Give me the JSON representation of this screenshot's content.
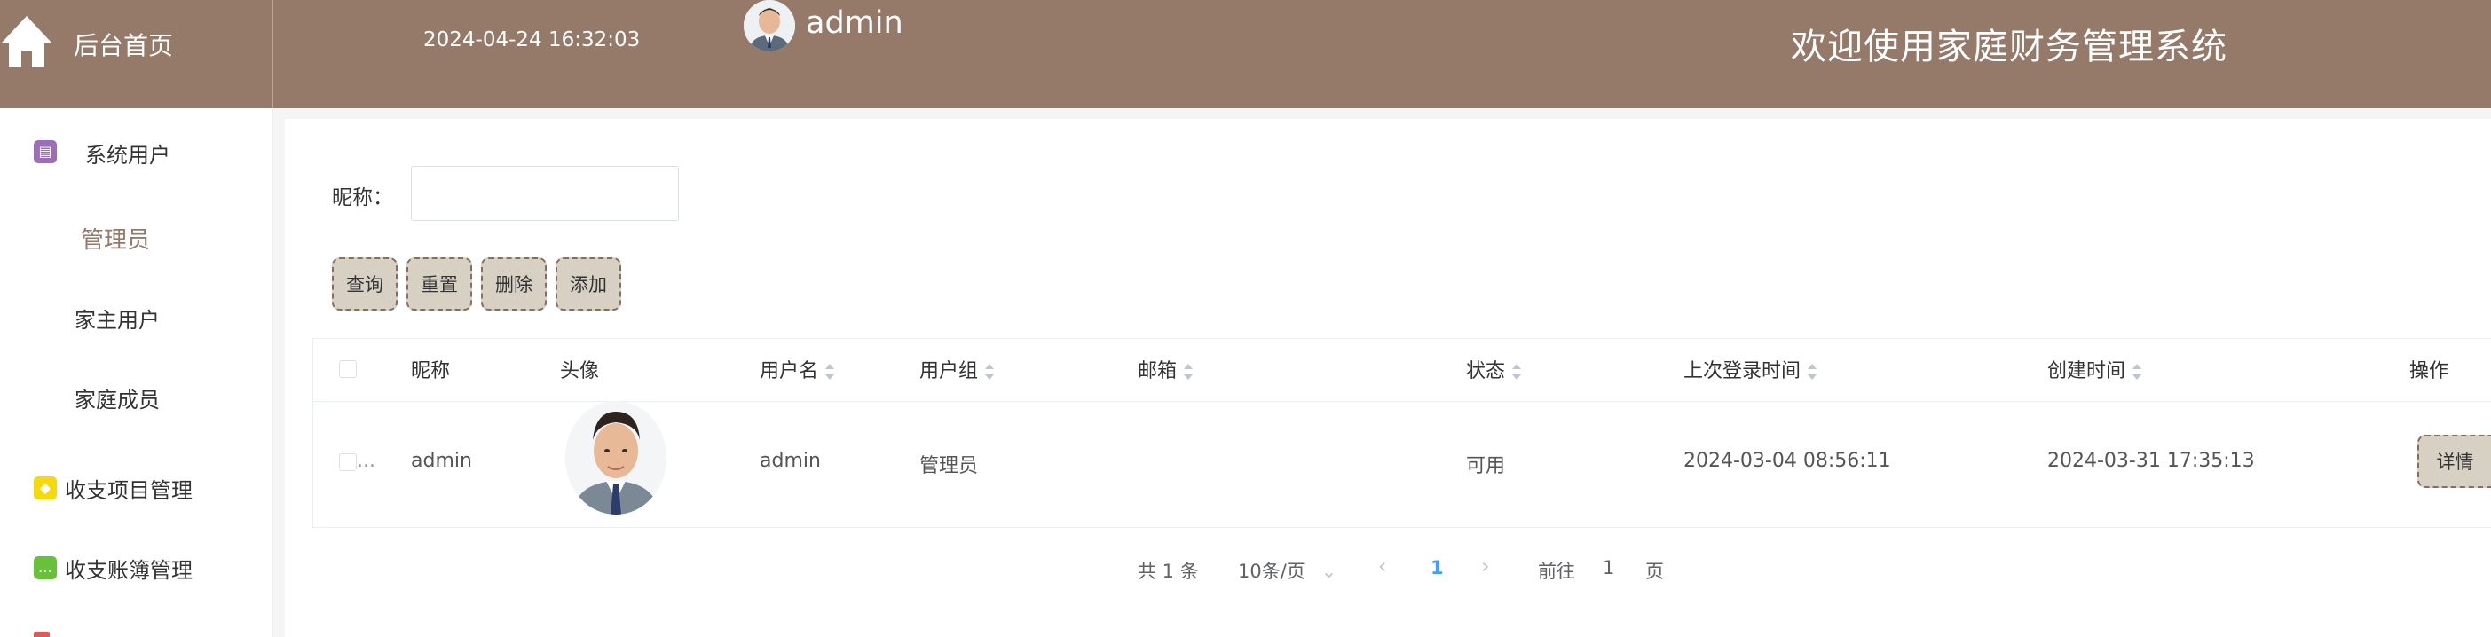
{
  "header": {
    "home_label": "后台首页",
    "datetime": "2024-04-24 16:32:03",
    "username": "admin",
    "site_title": "欢迎使用家庭财务管理系统"
  },
  "sidebar": {
    "items": [
      {
        "label": "系统用户",
        "icon": "archive-icon",
        "color": "#9b6fb8"
      },
      {
        "label": "管理员",
        "active": true
      },
      {
        "label": "家主用户"
      },
      {
        "label": "家庭成员"
      },
      {
        "label": "收支项目管理",
        "icon": "cube-icon",
        "color": "#f5d90a"
      },
      {
        "label": "收支账簿管理",
        "icon": "chat-icon",
        "color": "#67c23a"
      }
    ]
  },
  "filter": {
    "label": "昵称：",
    "nickname_value": "",
    "nickname_placeholder": ""
  },
  "toolbar": {
    "query_label": "查询",
    "reset_label": "重置",
    "delete_label": "删除",
    "add_label": "添加"
  },
  "table": {
    "headers": {
      "nickname": "昵称",
      "avatar": "头像",
      "username": "用户名",
      "group": "用户组",
      "email": "邮箱",
      "status": "状态",
      "last_login": "上次登录时间",
      "created": "创建时间",
      "actions": "操作"
    },
    "rows": [
      {
        "checkbox_text": "...",
        "nickname": "admin",
        "username": "admin",
        "group": "管理员",
        "email": "",
        "status": "可用",
        "last_login": "2024-03-04 08:56:11",
        "created": "2024-03-31 17:35:13",
        "detail_label": "详情"
      }
    ]
  },
  "pagination": {
    "total": "共 1 条",
    "page_size": "10条/页",
    "current_page": "1",
    "goto_prefix": "前往",
    "goto_value": "1",
    "goto_suffix": "页"
  },
  "colors": {
    "header_bg": "#957a6a",
    "button_bg": "#d7d1c4",
    "accent": "#409eff"
  }
}
